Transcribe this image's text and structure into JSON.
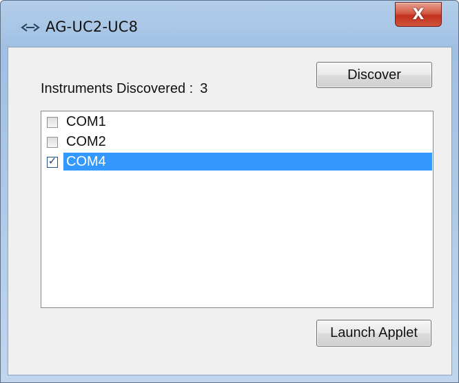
{
  "window": {
    "title": "AG-UC2-UC8",
    "close_glyph": "X"
  },
  "instruments": {
    "label": "Instruments Discovered :",
    "count": "3"
  },
  "buttons": {
    "discover": "Discover",
    "launch": "Launch Applet"
  },
  "ports": [
    {
      "label": "COM1",
      "checked": false,
      "selected": false
    },
    {
      "label": "COM2",
      "checked": false,
      "selected": false
    },
    {
      "label": "COM4",
      "checked": true,
      "selected": true
    }
  ],
  "colors": {
    "selection": "#3399ff",
    "close_button": "#c3321e",
    "frame": "#a9c6e6"
  },
  "icons": {
    "app": "connector-link-icon",
    "close": "close-icon",
    "check": "checkmark-icon"
  }
}
